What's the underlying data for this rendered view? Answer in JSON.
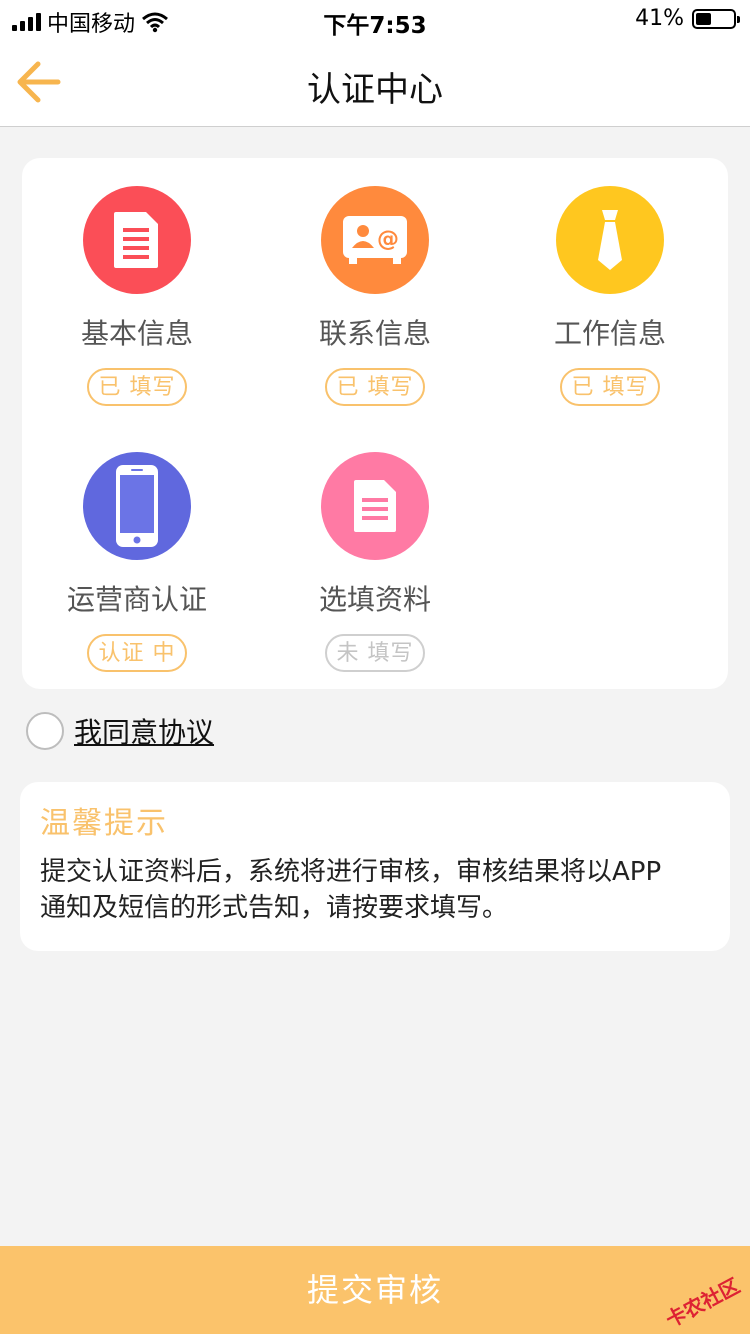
{
  "status_bar": {
    "carrier": "中国移动",
    "time": "下午7:53",
    "battery": "41%",
    "battery_level": 0.41
  },
  "nav": {
    "title": "认证中心"
  },
  "items": [
    {
      "label": "基本信息",
      "status": "已 填写",
      "color": "#fb4e57"
    },
    {
      "label": "联系信息",
      "status": "已 填写",
      "color": "#ff8a3d"
    },
    {
      "label": "工作信息",
      "status": "已 填写",
      "color": "#ffc71f"
    },
    {
      "label": "运营商认证",
      "status": "认证 中",
      "color": "#6068de"
    },
    {
      "label": "选填资料",
      "status": "未 填写",
      "color": "#ff7aa4"
    }
  ],
  "agreement": {
    "label": "我同意协议"
  },
  "tips": {
    "title": "温馨提示",
    "body": "提交认证资料后，系统将进行审核，审核结果将以APP通知及短信的形式告知，请按要求填写。"
  },
  "submit": {
    "label": "提交审核"
  },
  "watermark": "卡农社区"
}
